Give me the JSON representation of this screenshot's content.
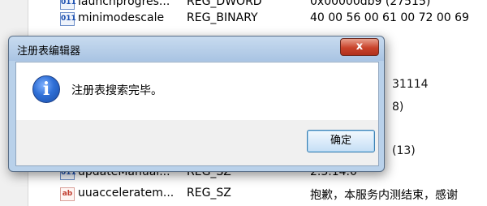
{
  "registry_list": {
    "rows": [
      {
        "icon": "binary-value-icon",
        "icon_text": "011",
        "name": "launchprogres...",
        "type": "REG_DWORD",
        "data": "0x00000db9 (27515)"
      },
      {
        "icon": "binary-value-icon",
        "icon_text": "011",
        "name": "minimodescale",
        "type": "REG_BINARY",
        "data": "40 00 56 00 61 00 72 00 69"
      },
      {
        "icon": "binary-value-icon",
        "icon_text": "011",
        "name": "updateManual...",
        "type": "REG_SZ",
        "data": "2.3.14.0"
      },
      {
        "icon": "string-value-icon",
        "icon_text": "ab",
        "name": "uuacceleratem...",
        "type": "REG_SZ",
        "data": "抱歉，本服务内测结束，感谢"
      }
    ],
    "partial_values": [
      "31114",
      "8)",
      "(13)"
    ]
  },
  "dialog": {
    "title": "注册表编辑器",
    "close_label": "x",
    "icon": "info-icon",
    "message": "注册表搜索完毕。",
    "ok_label": "确定"
  }
}
